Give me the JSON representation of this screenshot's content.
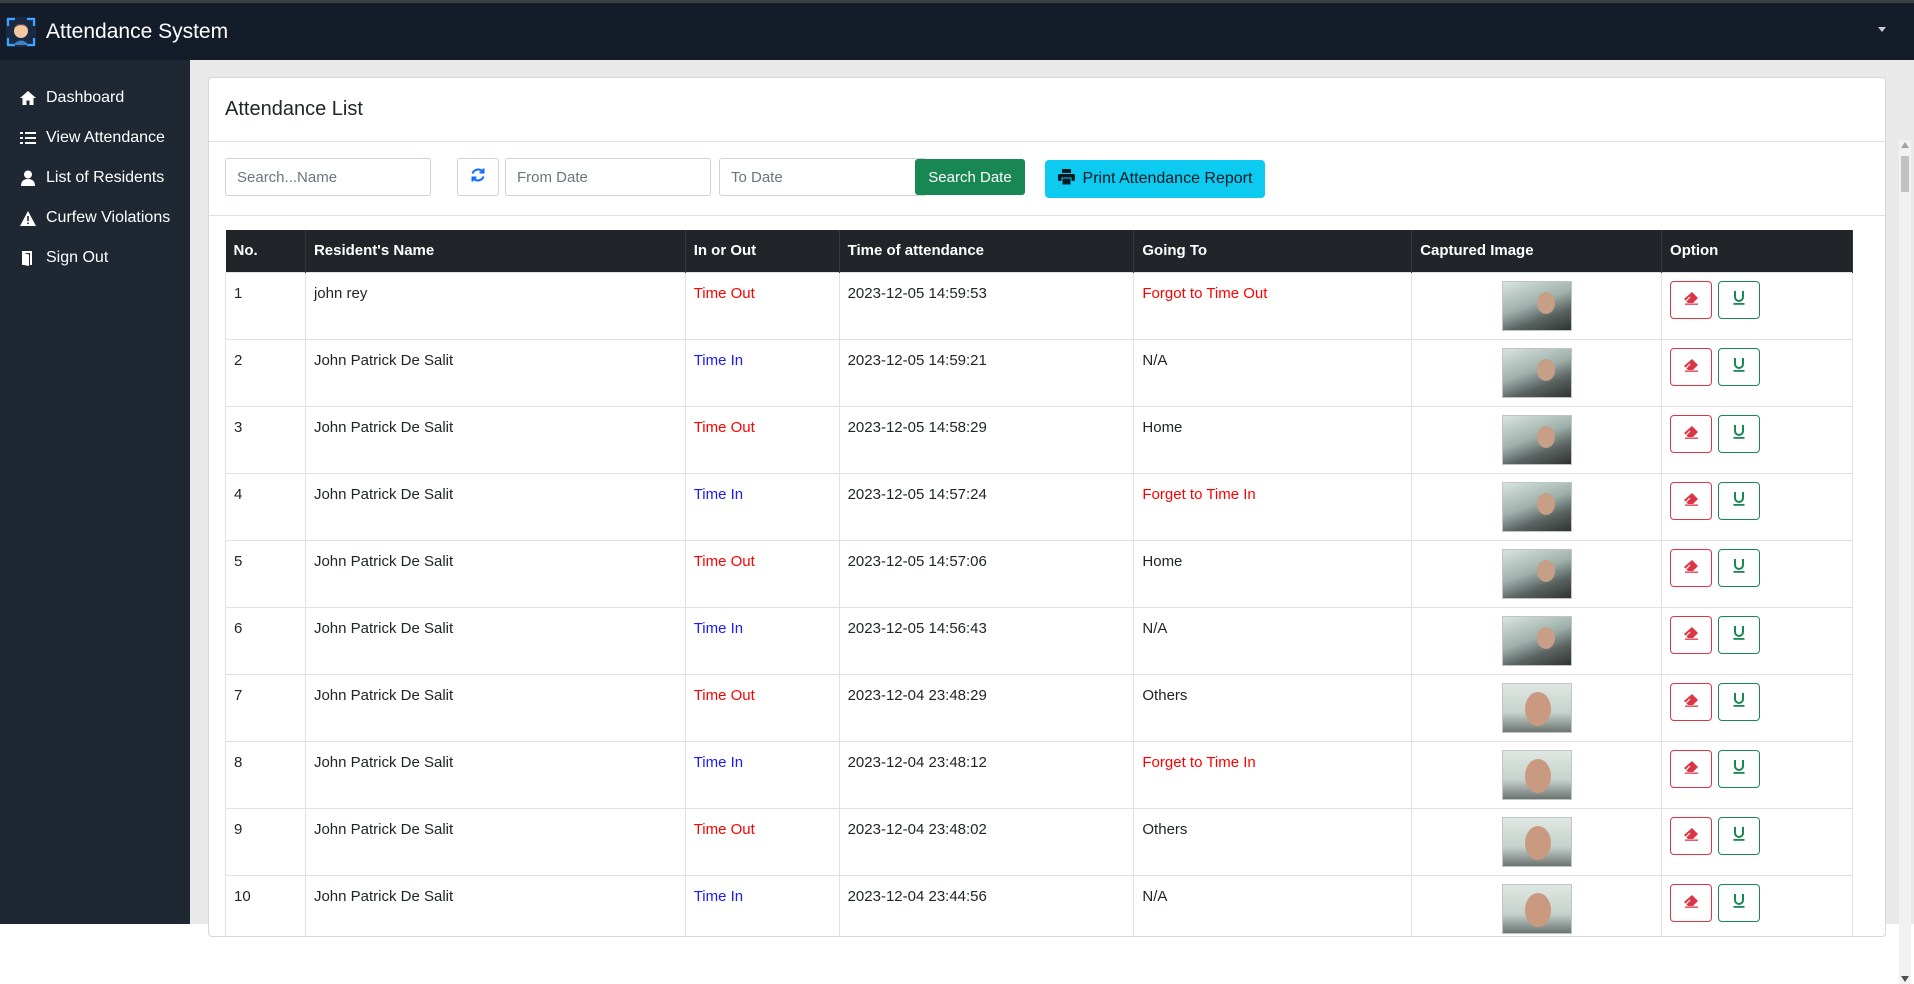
{
  "app": {
    "title": "Attendance System",
    "logo_icon": "face-scan-icon"
  },
  "sidebar": {
    "items": [
      {
        "label": "Dashboard",
        "icon": "home-icon"
      },
      {
        "label": "View Attendance",
        "icon": "list-icon"
      },
      {
        "label": "List of Residents",
        "icon": "user-icon"
      },
      {
        "label": "Curfew Violations",
        "icon": "warning-icon"
      },
      {
        "label": "Sign Out",
        "icon": "door-exit-icon"
      }
    ]
  },
  "main": {
    "title": "Attendance List",
    "filters": {
      "search_placeholder": "Search...Name",
      "from_placeholder": "From Date",
      "to_placeholder": "To Date",
      "search_button": "Search Date",
      "print_button": "Print Attendance Report"
    },
    "table": {
      "headers": [
        "No.",
        "Resident's Name",
        "In or Out",
        "Time of attendance",
        "Going To",
        "Captured Image",
        "Option"
      ],
      "rows": [
        {
          "no": "1",
          "name": "john rey",
          "io": "Time Out",
          "time": "2023-12-05 14:59:53",
          "going": "Forgot to Time Out"
        },
        {
          "no": "2",
          "name": "John Patrick De Salit",
          "io": "Time In",
          "time": "2023-12-05 14:59:21",
          "going": "N/A"
        },
        {
          "no": "3",
          "name": "John Patrick De Salit",
          "io": "Time Out",
          "time": "2023-12-05 14:58:29",
          "going": "Home"
        },
        {
          "no": "4",
          "name": "John Patrick De Salit",
          "io": "Time In",
          "time": "2023-12-05 14:57:24",
          "going": "Forget to Time In"
        },
        {
          "no": "5",
          "name": "John Patrick De Salit",
          "io": "Time Out",
          "time": "2023-12-05 14:57:06",
          "going": "Home"
        },
        {
          "no": "6",
          "name": "John Patrick De Salit",
          "io": "Time In",
          "time": "2023-12-05 14:56:43",
          "going": "N/A"
        },
        {
          "no": "7",
          "name": "John Patrick De Salit",
          "io": "Time Out",
          "time": "2023-12-04 23:48:29",
          "going": "Others"
        },
        {
          "no": "8",
          "name": "John Patrick De Salit",
          "io": "Time In",
          "time": "2023-12-04 23:48:12",
          "going": "Forget to Time In"
        },
        {
          "no": "9",
          "name": "John Patrick De Salit",
          "io": "Time Out",
          "time": "2023-12-04 23:48:02",
          "going": "Others"
        },
        {
          "no": "10",
          "name": "John Patrick De Salit",
          "io": "Time In",
          "time": "2023-12-04 23:44:56",
          "going": "N/A"
        }
      ]
    }
  },
  "colors": {
    "topbar": "#141b29",
    "sidebar": "#1f2733",
    "time_out": "#ff0000",
    "time_in": "#1a1aff",
    "warning_going": "#ff0000",
    "search_button": "#198754",
    "print_button": "#0dcaf0",
    "delete_outline": "#dc3545",
    "update_outline": "#198754"
  }
}
